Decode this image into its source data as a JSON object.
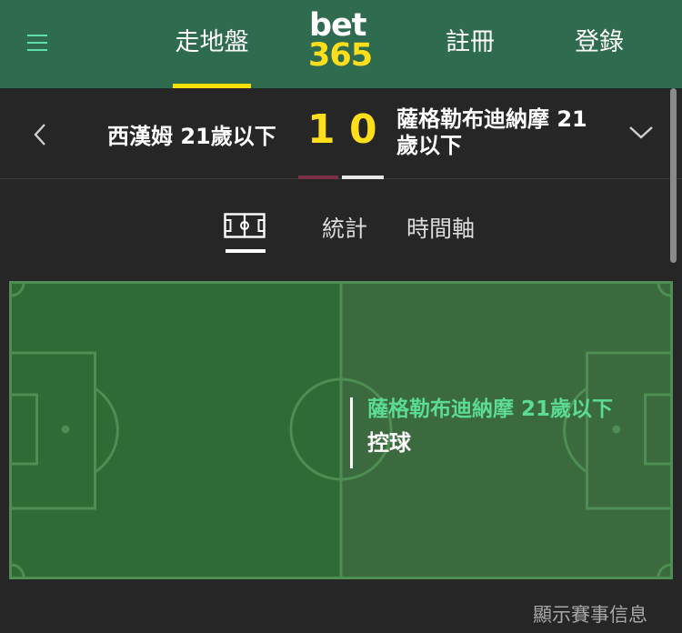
{
  "nav": {
    "live_label": "走地盤",
    "register_label": "註冊",
    "login_label": "登錄",
    "logo_top": "bet",
    "logo_bottom": "365",
    "accent": "#f6e10a",
    "bg": "#2f6b4f"
  },
  "match": {
    "home_team": "西漢姆 21歲以下",
    "away_team": "薩格勒布迪納摩 21歲以下",
    "home_score": "1",
    "away_score": "0",
    "home_color": "#7a3143",
    "away_color": "#e8e8e8"
  },
  "tabs": {
    "pitch_icon": "pitch-icon",
    "stats_label": "統計",
    "timeline_label": "時間軸"
  },
  "pitch": {
    "possession_team": "薩格勒布迪納摩 21歲以下",
    "possession_action": "控球"
  },
  "footer": {
    "match_info_label": "顯示賽事信息"
  }
}
